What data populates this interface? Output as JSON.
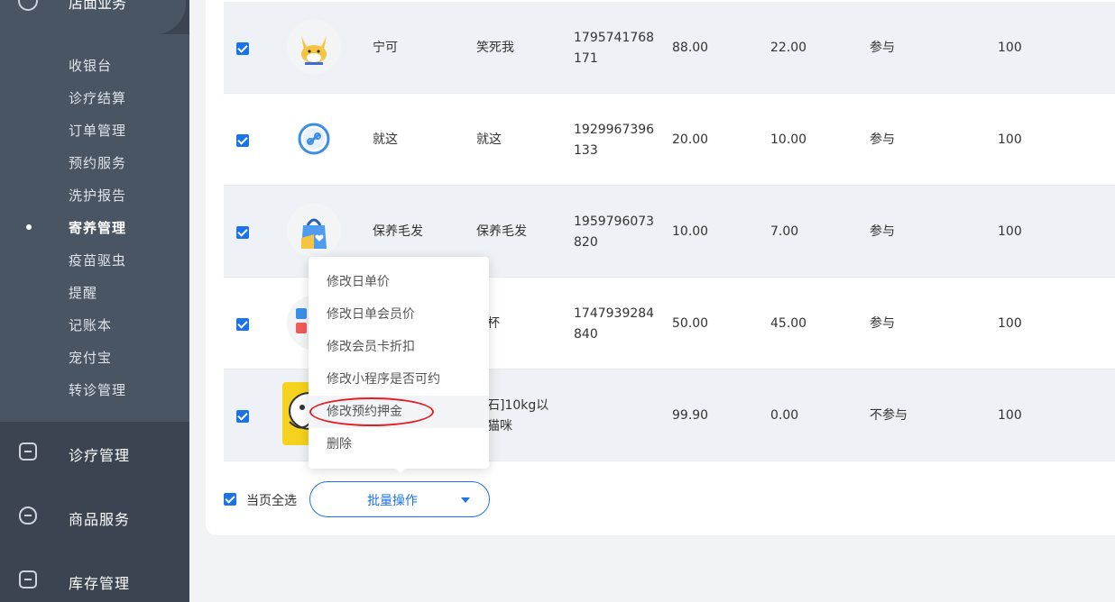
{
  "sidebar": {
    "top_section": {
      "label": "店面业务",
      "icon": "info-icon"
    },
    "submenu": [
      {
        "label": "收银台"
      },
      {
        "label": "诊疗结算"
      },
      {
        "label": "订单管理"
      },
      {
        "label": "预约服务"
      },
      {
        "label": "洗护报告"
      },
      {
        "label": "寄养管理",
        "active": true
      },
      {
        "label": "疫苗驱虫"
      },
      {
        "label": "提醒"
      },
      {
        "label": "记账本"
      },
      {
        "label": "宠付宝"
      },
      {
        "label": "转诊管理"
      }
    ],
    "sections": [
      {
        "label": "诊疗管理",
        "icon": "medical-kit-icon"
      },
      {
        "label": "商品服务",
        "icon": "shopping-bag-icon"
      },
      {
        "label": "库存管理",
        "icon": "inventory-box-icon"
      }
    ]
  },
  "table": {
    "rows": [
      {
        "checked": true,
        "image": "shiba-dog-icon",
        "name": "宁可",
        "nickname": "笑死我",
        "phone": "17957417 68171",
        "phone_display": "1795741768171",
        "day_price": "88.00",
        "member_price": "22.00",
        "participate": "参与",
        "stock": "100"
      },
      {
        "checked": true,
        "image": "link-circle-icon",
        "name": "就这",
        "nickname": "就这",
        "phone_display": "1929967396133",
        "day_price": "20.00",
        "member_price": "10.00",
        "participate": "参与",
        "stock": "100"
      },
      {
        "checked": true,
        "image": "shopping-bag-heart-icon",
        "name": "保养毛发",
        "nickname": "保养毛发",
        "phone_display": "1959796073820",
        "day_price": "10.00",
        "member_price": "7.00",
        "participate": "参与",
        "stock": "100"
      },
      {
        "checked": true,
        "image": "app-grid-icon",
        "name": "",
        "nickname": "杯",
        "phone_display": "1747939284840",
        "day_price": "50.00",
        "member_price": "45.00",
        "participate": "参与",
        "stock": "100"
      },
      {
        "checked": true,
        "image": "cartoon-cat-icon",
        "name": "",
        "nickname": "石]10kg以\n猫咪",
        "phone_display": "",
        "day_price": "99.90",
        "member_price": "0.00",
        "participate": "不参与",
        "stock": "100"
      }
    ]
  },
  "dropdown": {
    "items": [
      {
        "label": "修改日单价"
      },
      {
        "label": "修改日单会员价"
      },
      {
        "label": "修改会员卡折扣"
      },
      {
        "label": "修改小程序是否可约"
      },
      {
        "label": "修改预约押金",
        "highlighted": true
      },
      {
        "label": "删除"
      }
    ]
  },
  "footer": {
    "select_all_label": "当页全选",
    "select_all_checked": true,
    "batch_button_label": "批量操作"
  },
  "colors": {
    "accent": "#1a73e8",
    "sidebar_bg": "#3b4450",
    "highlight_ring": "#e02020"
  }
}
